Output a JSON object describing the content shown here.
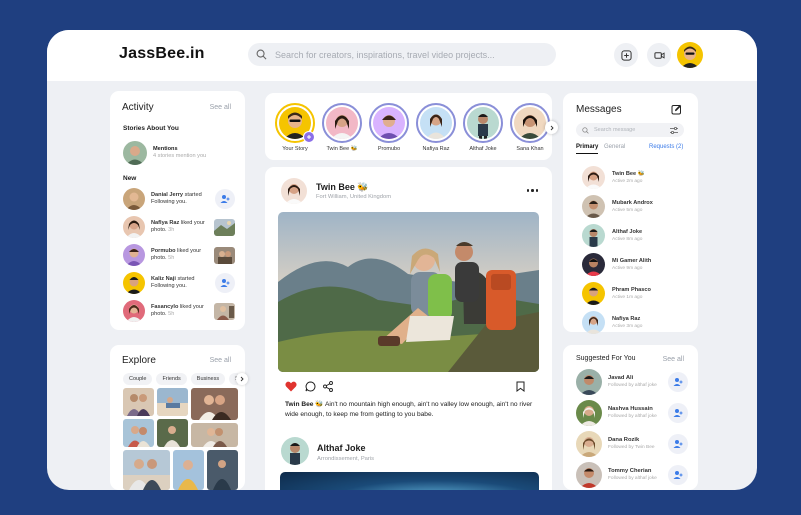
{
  "app": {
    "logo": "JassBee.in"
  },
  "search": {
    "placeholder": "Search for creators, inspirations, travel video projects..."
  },
  "activity": {
    "title": "Activity",
    "see_all": "See all",
    "stories_heading": "Stories About You",
    "mentions": {
      "title": "Mentions",
      "subtitle": "4 stories mention you"
    },
    "new_heading": "New",
    "items": [
      {
        "name": "Danial Jerry",
        "action": "started Following you.",
        "time": "",
        "kind": "follow"
      },
      {
        "name": "Naflya Raz",
        "action": "liked your photo.",
        "time": "3h",
        "kind": "photo"
      },
      {
        "name": "Pormubo",
        "action": "liked your photo.",
        "time": "5h",
        "kind": "photo"
      },
      {
        "name": "Kaliz Naji",
        "action": "started Following you.",
        "time": "5h",
        "kind": "follow"
      },
      {
        "name": "Fasancylo",
        "action": "liked your photo.",
        "time": "5h",
        "kind": "photo"
      }
    ]
  },
  "explore": {
    "title": "Explore",
    "see_all": "See all",
    "chips": [
      "Couple",
      "Friends",
      "Business",
      "Sp"
    ]
  },
  "stories": [
    {
      "name": "Your Story",
      "color": "#f5c400"
    },
    {
      "name": "Twin Bee 🐝",
      "color": "#f2b8c6"
    },
    {
      "name": "Promubo",
      "color": "#d9b3ff"
    },
    {
      "name": "Nafiya Raz",
      "color": "#c5e0f5"
    },
    {
      "name": "Althaf Joke",
      "color": "#b9d9d0"
    },
    {
      "name": "Sana Khan",
      "color": "#f0d8c0"
    }
  ],
  "post1": {
    "author": "Twin Bee 🐝",
    "location": "Fort William, United Kingdom",
    "caption_author": "Twin Bee 🐝",
    "caption": "Ain't no mountain high enough, ain't no valley low enough, ain't no river wide enough, to keep me from getting to you babe."
  },
  "post2": {
    "author": "Althaf Joke",
    "location": "Arrondissement, Paris"
  },
  "messages": {
    "title": "Messages",
    "search_placeholder": "Search message",
    "tabs": [
      "Primary",
      "General",
      "Requests (2)"
    ],
    "items": [
      {
        "name": "Twin Bee 🐝",
        "status": "Active 2m ago"
      },
      {
        "name": "Mubark Androx",
        "status": "Active 5m ago"
      },
      {
        "name": "Althaf Joke",
        "status": "Active 8m ago"
      },
      {
        "name": "Mi Gamer Alith",
        "status": "Active 9m ago"
      },
      {
        "name": "Phram Phasco",
        "status": "Active 1m ago"
      },
      {
        "name": "Nafiya Raz",
        "status": "Active 3m ago"
      }
    ]
  },
  "suggested": {
    "title": "Suggested For You",
    "see_all": "See all",
    "items": [
      {
        "name": "Javad Ali",
        "sub": "Followed by althaf joke"
      },
      {
        "name": "Nashva Hussain",
        "sub": "Followed by althaf joke"
      },
      {
        "name": "Dana Rozik",
        "sub": "Followed by Twin Bee"
      },
      {
        "name": "Tommy Cherian",
        "sub": "Followed by althaf joke"
      }
    ]
  },
  "colors": {
    "background": "#1f3f80",
    "accent": "#2f6fe0",
    "like": "#e0342f",
    "story_ring": "#f5c400"
  }
}
